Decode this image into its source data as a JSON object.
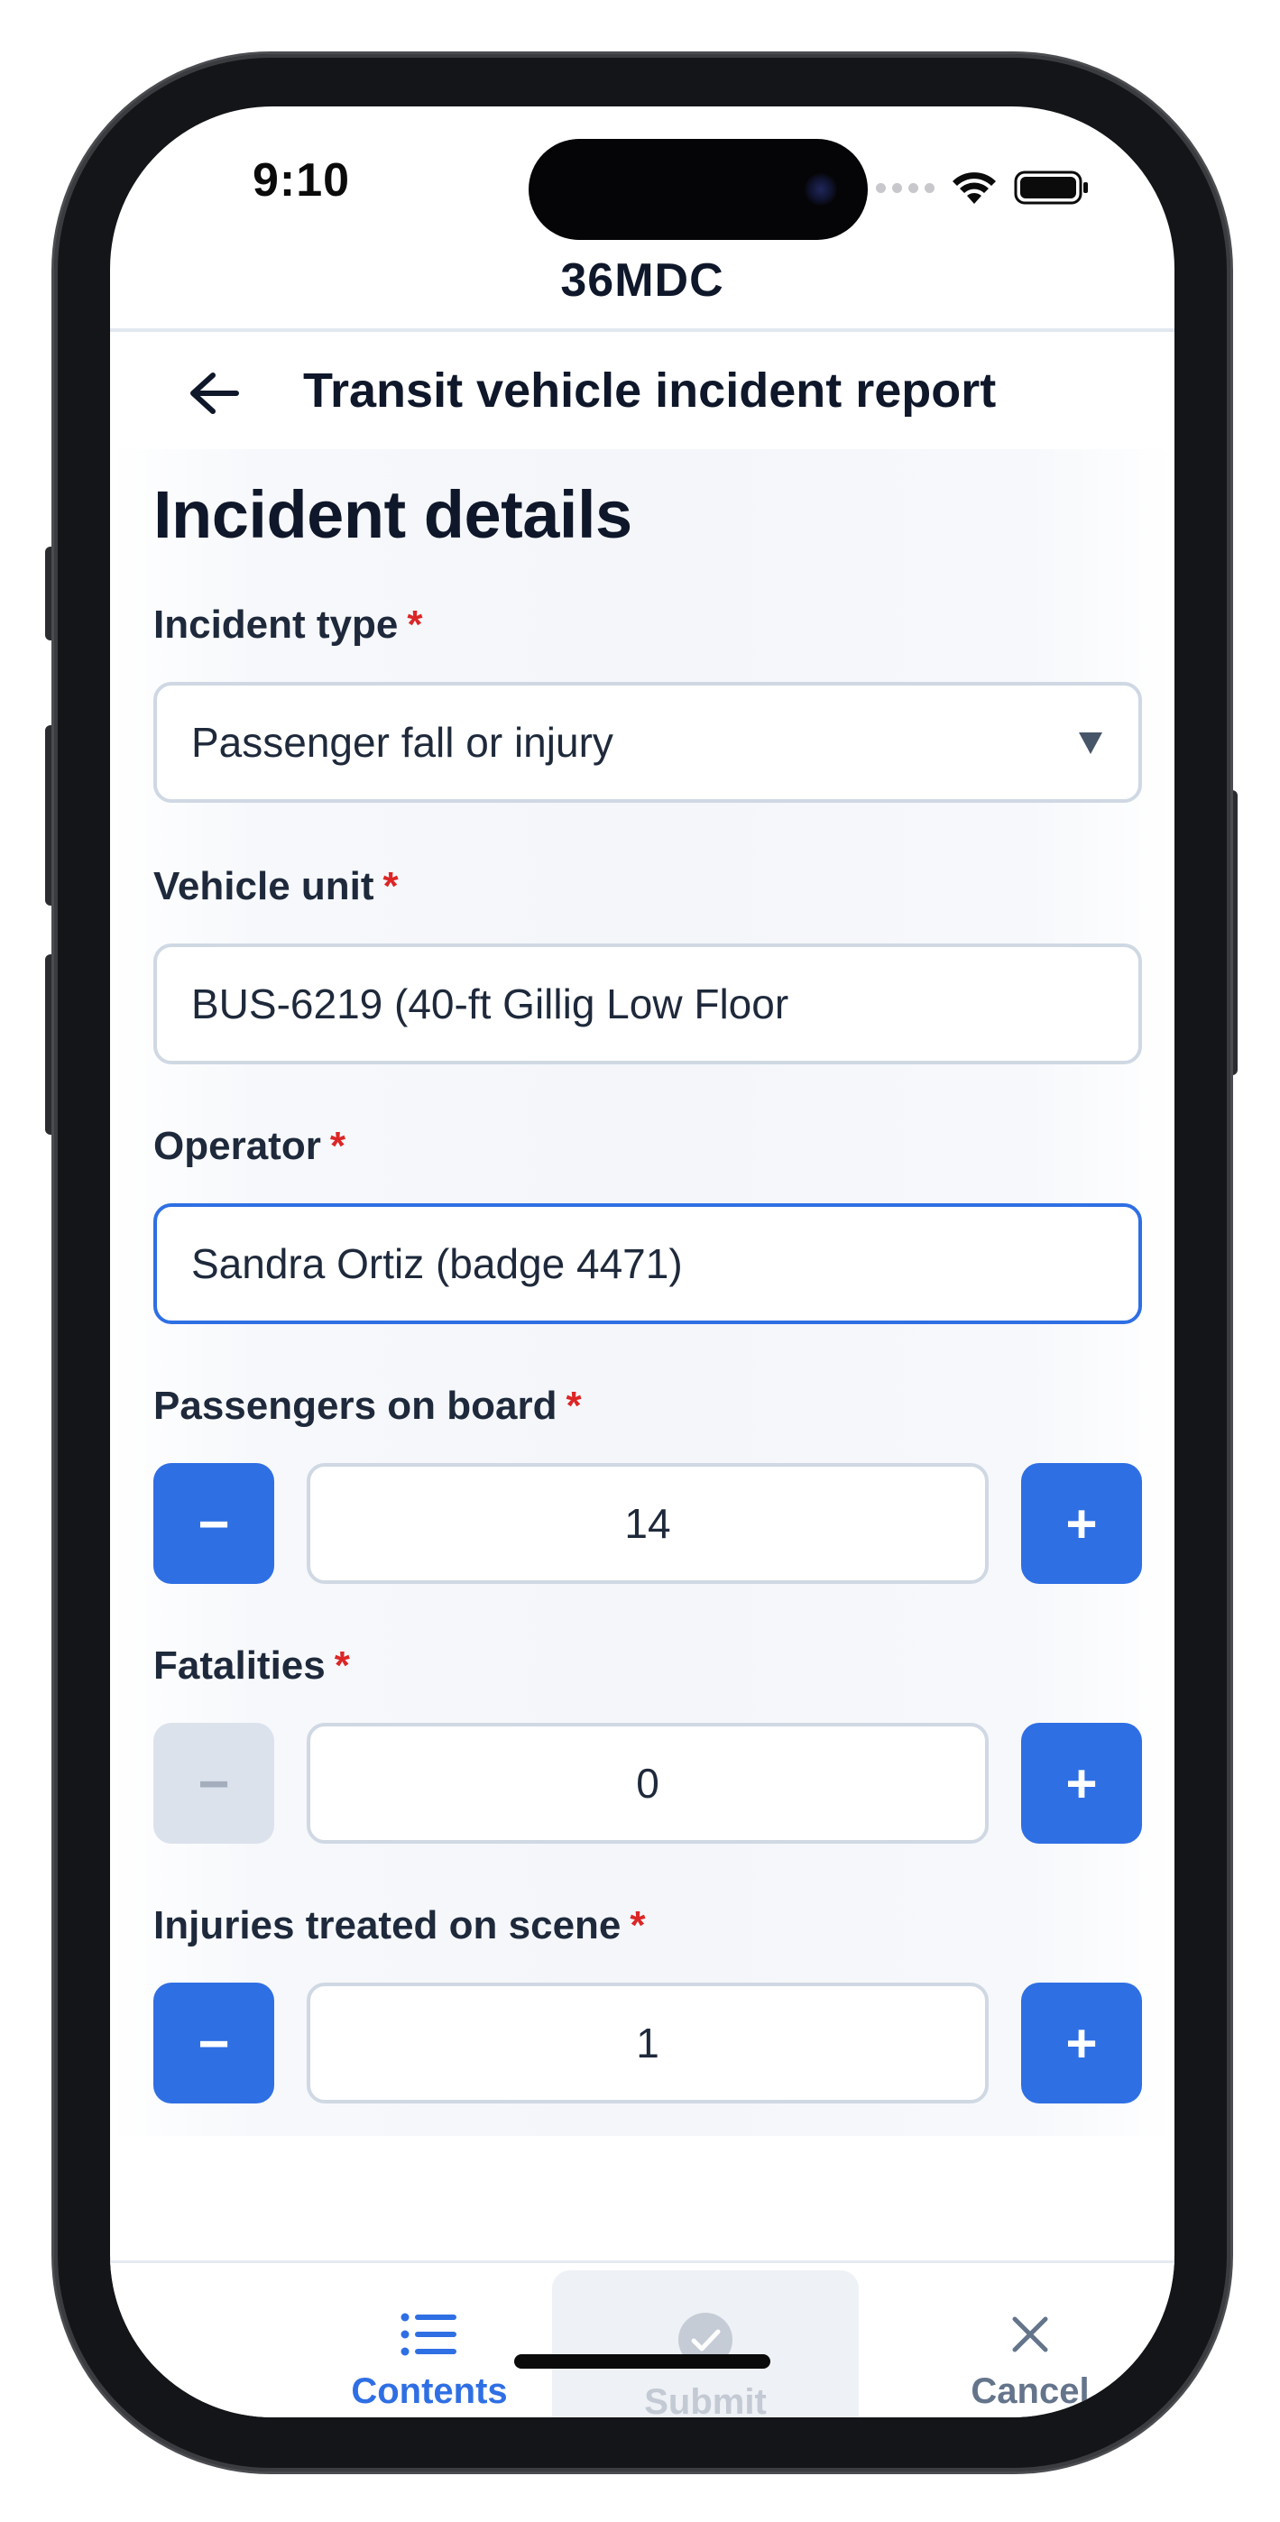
{
  "status_bar": {
    "time": "9:10"
  },
  "app": {
    "title": "36MDC"
  },
  "nav": {
    "title": "Transit vehicle incident report"
  },
  "section": {
    "title": "Incident details"
  },
  "required_marker": "*",
  "fields": {
    "incident_type": {
      "label": "Incident type",
      "value": "Passenger fall or injury"
    },
    "vehicle_unit": {
      "label": "Vehicle unit",
      "value": "BUS-6219 (40-ft Gillig Low Floor"
    },
    "operator": {
      "label": "Operator",
      "value": "Sandra Ortiz (badge 4471)"
    },
    "passengers": {
      "label": "Passengers on board",
      "value": "14",
      "minus": "−",
      "plus": "+"
    },
    "fatalities": {
      "label": "Fatalities",
      "value": "0",
      "minus": "−",
      "plus": "+"
    },
    "injuries": {
      "label": "Injuries treated on scene",
      "value": "1",
      "minus": "−",
      "plus": "+"
    }
  },
  "bottom_bar": {
    "contents_label": "Contents",
    "submit_label": "Submit",
    "cancel_label": "Cancel"
  },
  "icons": {
    "back": "arrow-left-icon",
    "contents": "list-icon",
    "submit": "check-circle-icon",
    "cancel": "close-icon",
    "select": "caret-down-icon"
  },
  "colors": {
    "accent": "#2f6fe4",
    "required": "#dc2626",
    "disabled": "#dbe2ec"
  }
}
